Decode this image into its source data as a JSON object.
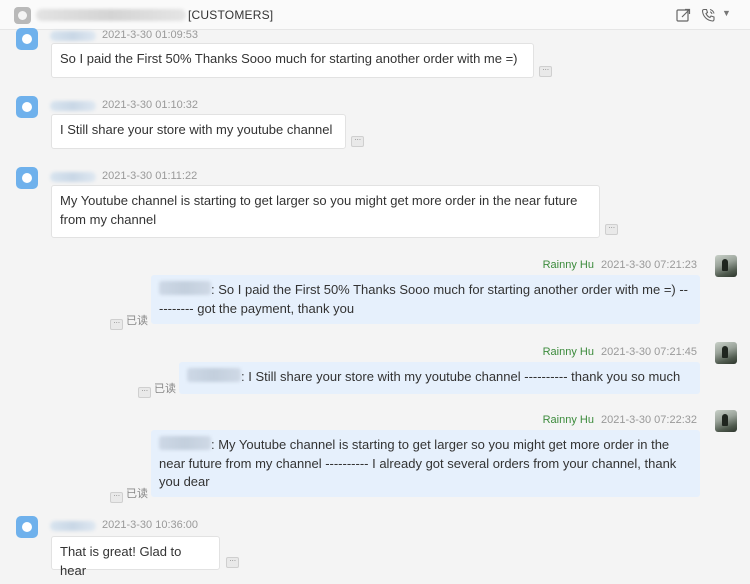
{
  "header": {
    "title": "[CUSTOMERS]",
    "icons": [
      "app-icon",
      "share-icon",
      "phone-icon",
      "chevron-down-icon"
    ]
  },
  "messages": [
    {
      "direction": "incoming",
      "timestamp": "2021-3-30 01:09:53",
      "text": "So I paid the First 50% Thanks Sooo much for starting another order with me =)"
    },
    {
      "direction": "incoming",
      "timestamp": "2021-3-30 01:10:32",
      "text": "I Still share your store with my youtube channel"
    },
    {
      "direction": "incoming",
      "timestamp": "2021-3-30 01:11:22",
      "text": "My Youtube channel is starting to get larger so you might get more order in the near future from my channel"
    },
    {
      "direction": "outgoing",
      "sender": "Rainny Hu",
      "timestamp": "2021-3-30 07:21:23",
      "text": ": So I paid the First 50% Thanks Sooo much for starting another order with me =) ---------- got the payment, thank you",
      "read_label": "已读"
    },
    {
      "direction": "outgoing",
      "sender": "Rainny Hu",
      "timestamp": "2021-3-30 07:21:45",
      "text": ": I Still share your store with my youtube channel ---------- thank you so much",
      "read_label": "已读"
    },
    {
      "direction": "outgoing",
      "sender": "Rainny Hu",
      "timestamp": "2021-3-30 07:22:32",
      "text": ": My Youtube channel is starting to get larger so you might get more order in the near future from my channel ---------- I already got several orders from your channel, thank you dear",
      "read_label": "已读"
    },
    {
      "direction": "incoming",
      "timestamp": "2021-3-30 10:36:00",
      "text": "That is great! Glad to hear"
    }
  ],
  "more_glyph": "···",
  "colors": {
    "outgoing_bubble": "#e6f0fc",
    "sender_name": "#3c8b3c",
    "timestamp": "#999999",
    "avatar_incoming": "#6fb1ec"
  }
}
